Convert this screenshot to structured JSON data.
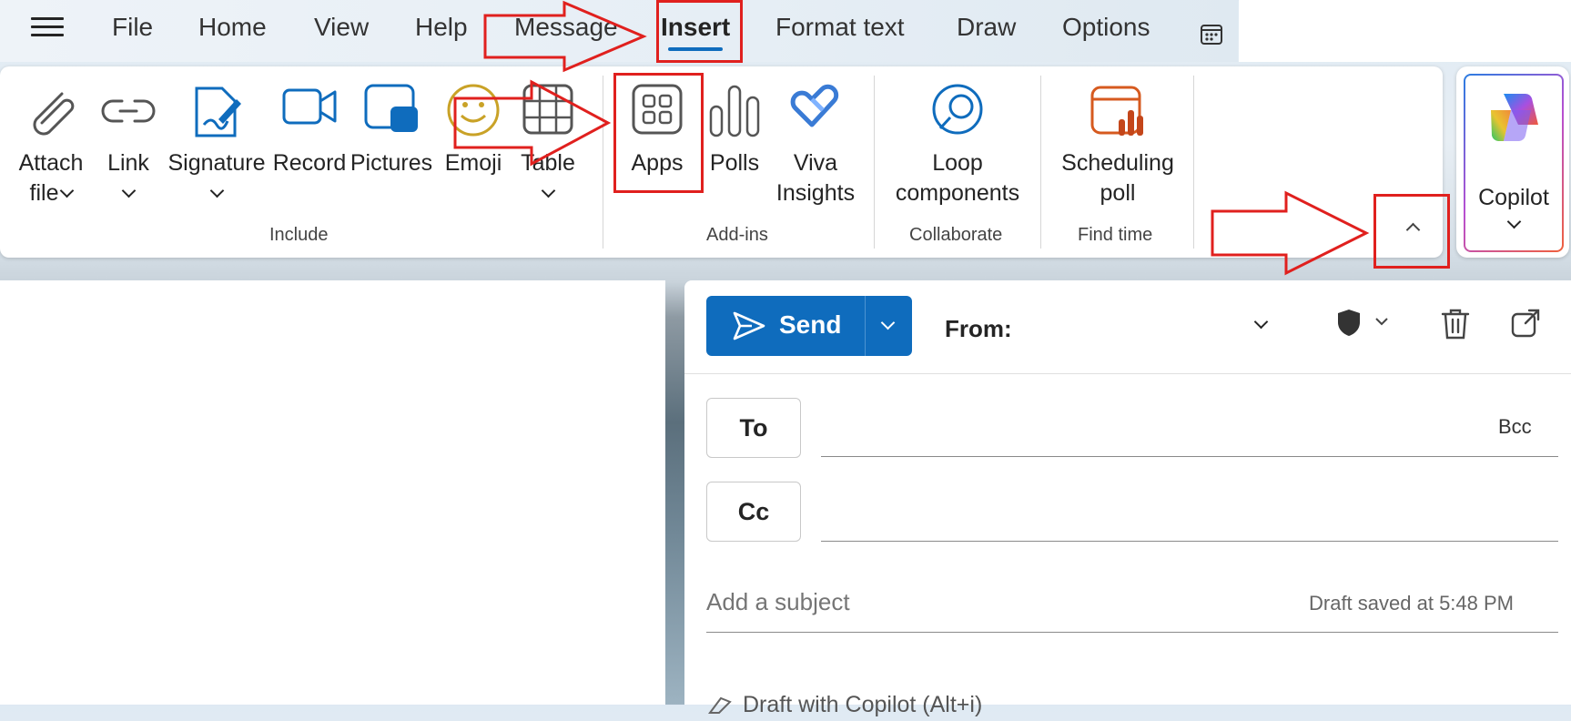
{
  "menu": {
    "tabs": [
      {
        "label": "File"
      },
      {
        "label": "Home"
      },
      {
        "label": "View"
      },
      {
        "label": "Help"
      },
      {
        "label": "Message"
      },
      {
        "label": "Insert"
      },
      {
        "label": "Format text"
      },
      {
        "label": "Draw"
      },
      {
        "label": "Options"
      }
    ],
    "active_tab": "Insert"
  },
  "ribbon": {
    "groups": [
      {
        "label": "Include"
      },
      {
        "label": "Add-ins"
      },
      {
        "label": "Collaborate"
      },
      {
        "label": "Find time"
      }
    ],
    "buttons": {
      "attach_file": {
        "line1": "Attach",
        "line2": "file",
        "icon": "paperclip-icon"
      },
      "link": {
        "line1": "Link",
        "icon": "link-icon"
      },
      "signature": {
        "line1": "Signature",
        "icon": "signature-icon"
      },
      "record": {
        "line1": "Record",
        "icon": "video-icon"
      },
      "pictures": {
        "line1": "Pictures",
        "icon": "pictures-icon"
      },
      "emoji": {
        "line1": "Emoji",
        "icon": "emoji-icon"
      },
      "table": {
        "line1": "Table",
        "icon": "table-icon"
      },
      "apps": {
        "line1": "Apps",
        "icon": "apps-grid-icon"
      },
      "polls": {
        "line1": "Polls",
        "icon": "polls-icon"
      },
      "viva_insights": {
        "line1": "Viva",
        "line2": "Insights",
        "icon": "viva-insights-icon"
      },
      "loop_components": {
        "line1": "Loop",
        "line2": "components",
        "icon": "loop-icon"
      },
      "scheduling_poll": {
        "line1": "Scheduling",
        "line2": "poll",
        "icon": "scheduling-poll-icon"
      },
      "copilot": {
        "line1": "Copilot",
        "icon": "copilot-icon"
      }
    }
  },
  "compose": {
    "send_label": "Send",
    "from_label": "From:",
    "to_label": "To",
    "cc_label": "Cc",
    "bcc_label": "Bcc",
    "subject_placeholder": "Add a subject",
    "draft_status": "Draft saved at 5:48 PM",
    "copilot_hint": "Draft with Copilot (Alt+i)"
  },
  "colors": {
    "accent": "#0f6cbd",
    "annotation_red": "#e0201e"
  }
}
